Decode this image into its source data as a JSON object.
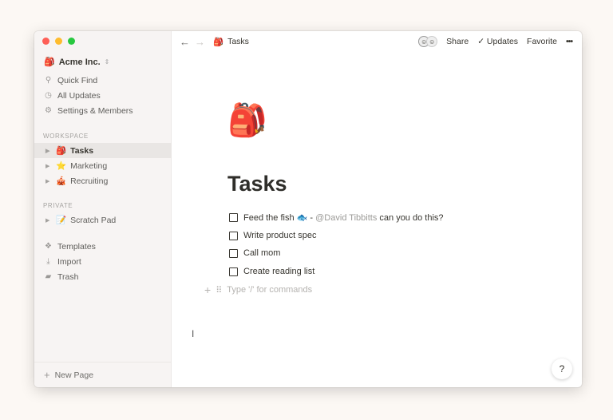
{
  "window": {
    "colors": {
      "close": "#fe5f57",
      "minimize": "#febc2e",
      "maximize": "#28c840"
    }
  },
  "sidebar": {
    "workspace_name": "Acme Inc.",
    "workspace_icon": "🎒",
    "nav": [
      {
        "label": "Quick Find",
        "icon": "search-icon"
      },
      {
        "label": "All Updates",
        "icon": "clock-icon"
      },
      {
        "label": "Settings & Members",
        "icon": "gear-icon"
      }
    ],
    "workspace_heading": "WORKSPACE",
    "workspace_pages": [
      {
        "label": "Tasks",
        "emoji": "🎒",
        "selected": true
      },
      {
        "label": "Marketing",
        "emoji": "⭐"
      },
      {
        "label": "Recruiting",
        "emoji": "🎪"
      }
    ],
    "private_heading": "PRIVATE",
    "private_pages": [
      {
        "label": "Scratch Pad",
        "emoji": "📝"
      }
    ],
    "tools": [
      {
        "label": "Templates",
        "icon": "templates-icon"
      },
      {
        "label": "Import",
        "icon": "import-icon"
      },
      {
        "label": "Trash",
        "icon": "trash-icon"
      }
    ],
    "new_page": "New Page"
  },
  "topbar": {
    "breadcrumb": "Tasks",
    "breadcrumb_emoji": "🎒",
    "share": "Share",
    "updates": "Updates",
    "favorite": "Favorite",
    "more": "•••"
  },
  "page": {
    "emoji": "🎒",
    "title": "Tasks",
    "todos": [
      {
        "text": "Feed the fish",
        "emoji": "🐟",
        "sep": " - ",
        "mention": "@David Tibbitts",
        "suffix": " can you do this?",
        "checked": false
      },
      {
        "text": "Write product spec",
        "checked": false
      },
      {
        "text": "Call mom",
        "checked": false
      },
      {
        "text": "Create reading list",
        "checked": false
      }
    ],
    "placeholder": "Type '/' for commands"
  },
  "help": "?"
}
